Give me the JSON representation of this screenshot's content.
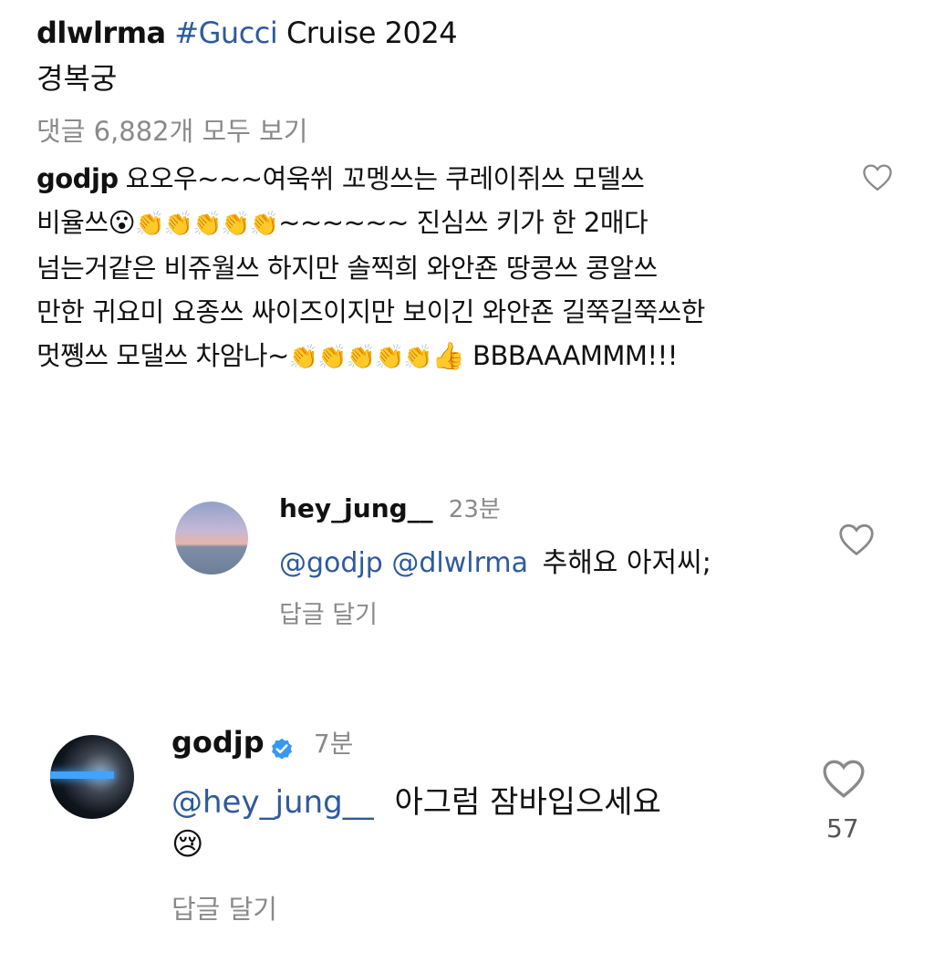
{
  "post": {
    "author": "dlwlrma",
    "hashtag": "#Gucci",
    "caption_rest": " Cruise 2024",
    "location_line": "경복궁",
    "view_all_comments": "댓글 6,882개 모두 보기"
  },
  "comment1": {
    "username": "godjp",
    "text_line1": "요오우~~~여욱쒸 꼬멩쓰는 쿠레이쥐쓰 모델쓰",
    "text_line2_prefix": "비율쓰",
    "text_line2_suffix": "~~~~~~ 진심쓰 키가 한 2매다",
    "text_line3": "넘는거같은 비쥬월쓰 하지만 솔찍희 와안죤 땅콩쓰 콩알쓰",
    "text_line4": "만한 귀요미 요종쓰 싸이즈이지만 보이긴 와안죤 길쭉길쭉쓰한",
    "text_line5_prefix": "멋쪵쓰 모댈쓰 차암나~",
    "text_line5_suffix": " BBBAAAMMM!!!",
    "emoji_surprised": "😮",
    "emoji_claps_a": "👏👏👏👏👏",
    "emoji_claps_b": "👏👏👏👏👏",
    "emoji_thumb": "👍",
    "heart_icon": "heart-outline-icon"
  },
  "reply1": {
    "username": "hey_jung__",
    "time": "23분",
    "mention1": "@godjp",
    "mention2": "@dlwlrma",
    "text": "추해요 아저씨;",
    "reply_label": "답글 달기"
  },
  "reply2": {
    "username": "godjp",
    "verified_icon": "verified-badge-icon",
    "time": "7분",
    "mention": "@hey_jung__",
    "text": "아그럼 잠바입으세요",
    "emoji": "😢",
    "reply_label": "답글 달기",
    "like_count": "57"
  },
  "colors": {
    "mention": "#2e5a9e",
    "muted": "#8a8a8a",
    "verified": "#3897f0"
  }
}
